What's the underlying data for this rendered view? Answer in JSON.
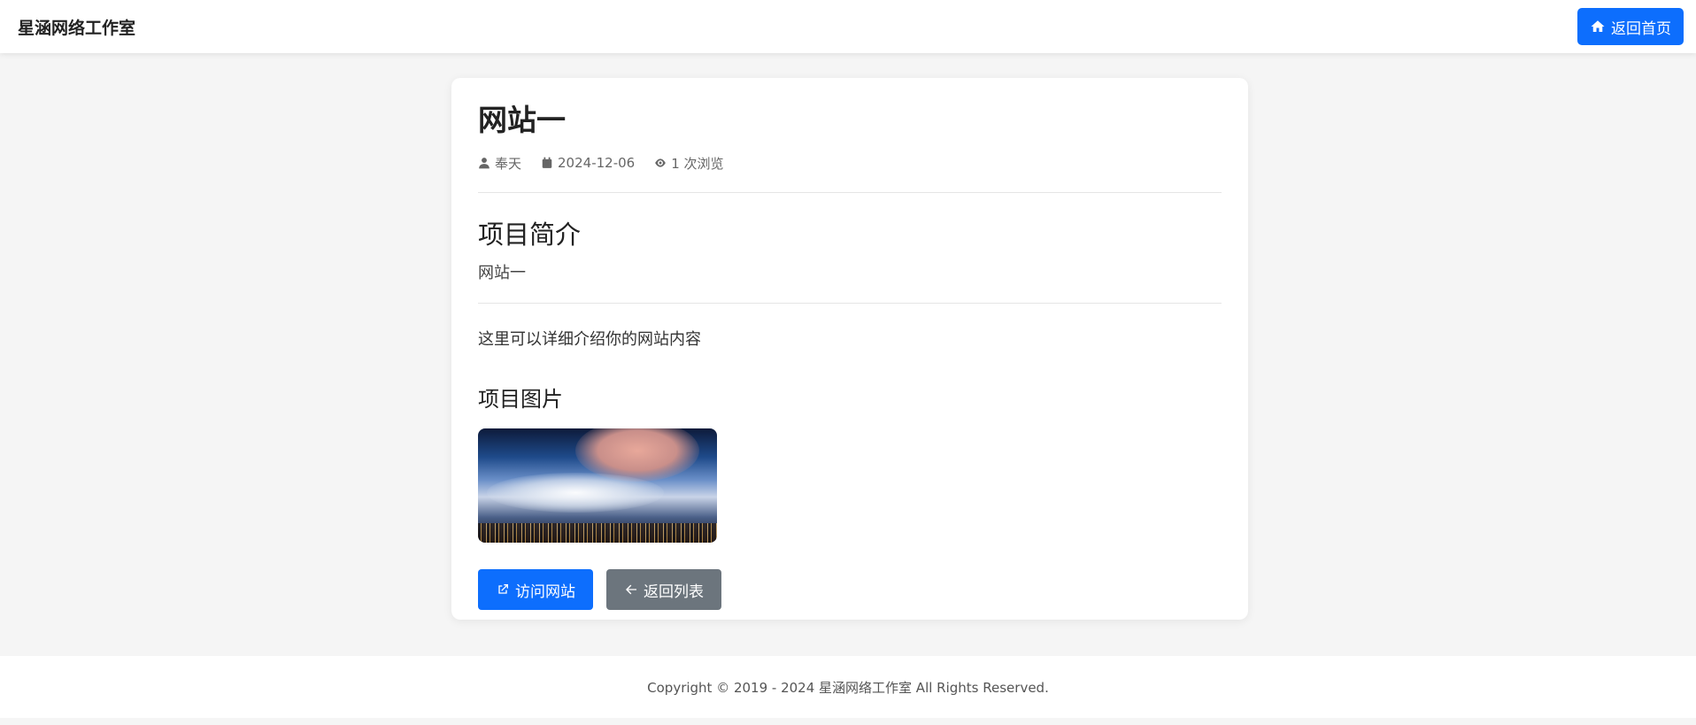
{
  "header": {
    "brand": "星涵网络工作室",
    "home_label": "返回首页",
    "accent": "#0d6efd"
  },
  "article": {
    "title": "网站一",
    "meta": {
      "author": "奉天",
      "date": "2024-12-06",
      "views": "1 次浏览"
    },
    "intro_heading": "项目简介",
    "intro_text": "网站一",
    "description": "这里可以详细介绍你的网站内容",
    "images_heading": "项目图片",
    "buttons": {
      "visit_label": "访问网站",
      "back_label": "返回列表"
    }
  },
  "footer": {
    "copyright": "Copyright © 2019 - 2024 星涵网络工作室 All Rights Reserved."
  }
}
